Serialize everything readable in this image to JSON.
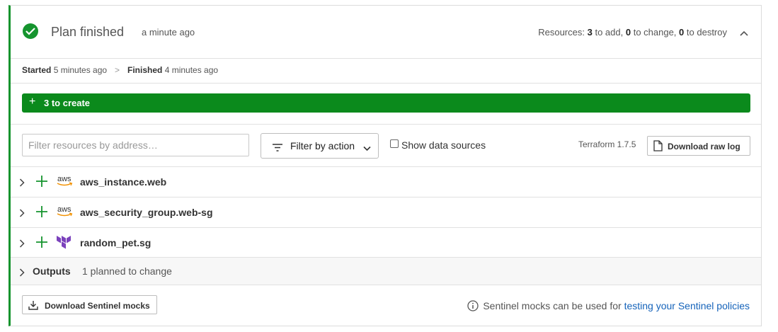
{
  "header": {
    "title": "Plan finished",
    "time_ago": "a minute ago",
    "resources_prefix": "Resources:",
    "add_count": "3",
    "add_text": "to add,",
    "change_count": "0",
    "change_text": "to change,",
    "destroy_count": "0",
    "destroy_text": "to destroy",
    "status_icon": "check-circle-icon",
    "status_color": "#15942e"
  },
  "timeline": {
    "started_label": "Started",
    "started_ago": "5 minutes ago",
    "separator": ">",
    "finished_label": "Finished",
    "finished_ago": "4 minutes ago"
  },
  "summary_bar": {
    "icon": "+",
    "label": "3 to create",
    "color": "#0b8a1c"
  },
  "toolbar": {
    "filter_placeholder": "Filter resources by address…",
    "filter_value": "",
    "action_label": "Filter by action",
    "show_data_sources_label": "Show data sources",
    "show_data_sources_checked": false,
    "terraform_version": "Terraform 1.7.5",
    "download_raw_log_label": "Download raw log"
  },
  "resources": [
    {
      "name": "aws_instance.web",
      "provider": "aws",
      "action": "create"
    },
    {
      "name": "aws_security_group.web-sg",
      "provider": "aws",
      "action": "create"
    },
    {
      "name": "random_pet.sg",
      "provider": "terraform",
      "action": "create"
    }
  ],
  "outputs": {
    "label": "Outputs",
    "count_text": "1 planned to change"
  },
  "footer": {
    "download_mocks_label": "Download Sentinel mocks",
    "info_text": "Sentinel mocks can be used for ",
    "info_link": "testing your Sentinel policies"
  }
}
